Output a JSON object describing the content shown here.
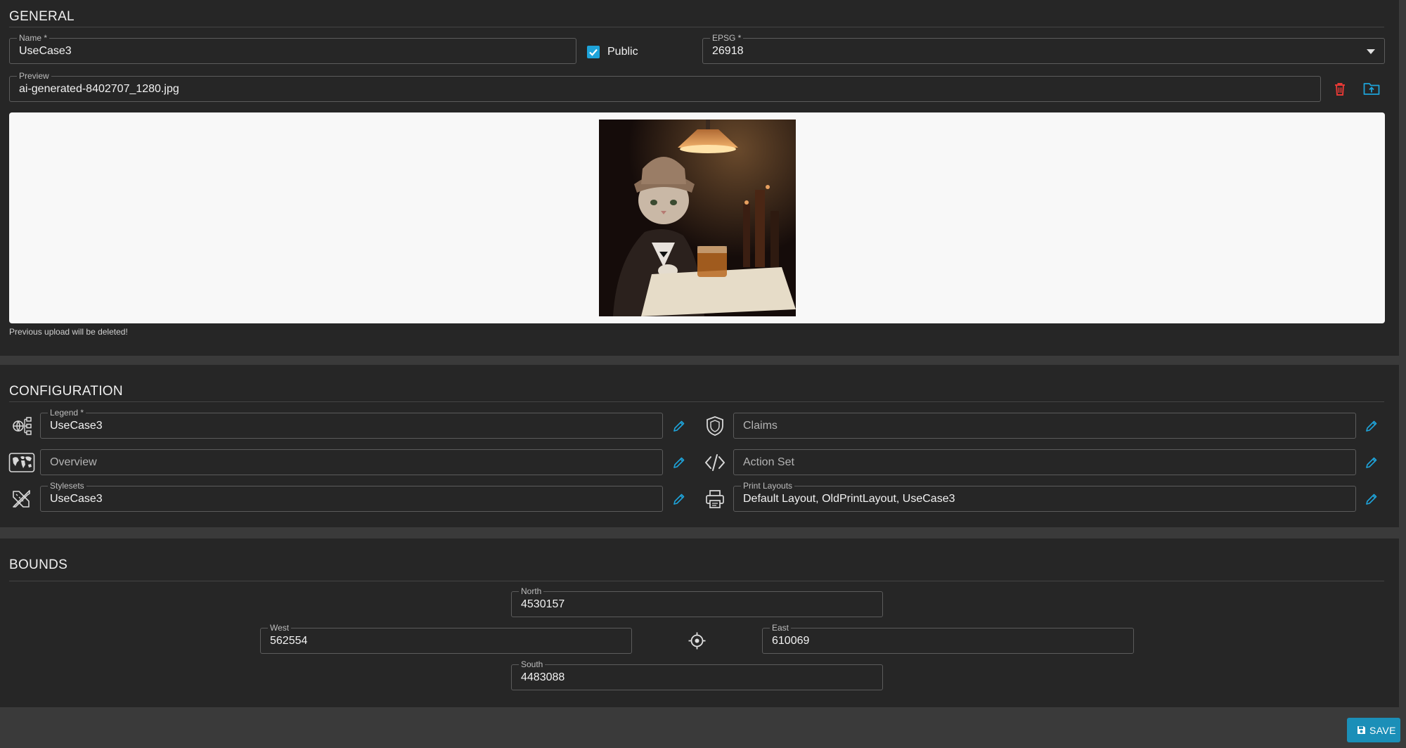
{
  "general": {
    "title": "GENERAL",
    "name": {
      "label": "Name *",
      "value": "UseCase3"
    },
    "public": {
      "label": "Public",
      "checked": true
    },
    "epsg": {
      "label": "EPSG *",
      "value": "26918"
    },
    "preview": {
      "label": "Preview",
      "value": "ai-generated-8402707_1280.jpg"
    },
    "hint": "Previous upload will be deleted!"
  },
  "configuration": {
    "title": "CONFIGURATION",
    "legend": {
      "label": "Legend *",
      "value": "UseCase3"
    },
    "claims": {
      "placeholder": "Claims"
    },
    "overview": {
      "placeholder": "Overview"
    },
    "action_set": {
      "placeholder": "Action Set"
    },
    "stylesets": {
      "label": "Stylesets",
      "value": "UseCase3"
    },
    "print_layouts": {
      "label": "Print Layouts",
      "value": "Default Layout, OldPrintLayout, UseCase3"
    }
  },
  "bounds": {
    "title": "BOUNDS",
    "north": {
      "label": "North",
      "value": "4530157"
    },
    "west": {
      "label": "West",
      "value": "562554"
    },
    "east": {
      "label": "East",
      "value": "610069"
    },
    "south": {
      "label": "South",
      "value": "4483088"
    }
  },
  "toolbar": {
    "save_label": "SAVE"
  },
  "icons": {
    "legend": "layers-tree-icon",
    "claims": "shield-icon",
    "overview": "world-map-icon",
    "action_set": "code-icon",
    "stylesets": "drafting-tools-icon",
    "print_layouts": "printer-icon",
    "edit": "pencil-icon",
    "delete": "trash-icon",
    "upload": "folder-upload-icon",
    "locate": "crosshair-icon",
    "save": "floppy-disk-icon"
  },
  "colors": {
    "accent": "#1ea3d9",
    "danger": "#e53935",
    "save_button": "#1b8fb8",
    "panel": "#262626"
  }
}
